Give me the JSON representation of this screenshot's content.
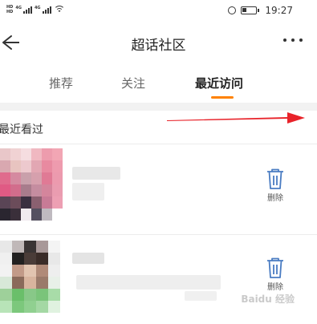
{
  "status_bar": {
    "hd1": "HD",
    "hd2": "HD",
    "net1": "4G",
    "net2": "4G",
    "time": "19:27"
  },
  "header": {
    "title": "超话社区",
    "back_icon": "back-arrow-icon",
    "more_icon": "more-dots-icon"
  },
  "tabs": [
    {
      "label": "推荐",
      "active": false
    },
    {
      "label": "关注",
      "active": false
    },
    {
      "label": "最近访问",
      "active": true
    }
  ],
  "section": {
    "title": "最近看过"
  },
  "items": [
    {
      "delete_label": "删除",
      "delete_icon": "trash-icon"
    },
    {
      "delete_label": "删除",
      "delete_icon": "trash-icon"
    }
  ],
  "colors": {
    "accent": "#ff8200",
    "arrow": "#e8232a",
    "band": "#f2f2f2",
    "trash": "#4a7cc2"
  },
  "watermark": "Baidu 经验"
}
